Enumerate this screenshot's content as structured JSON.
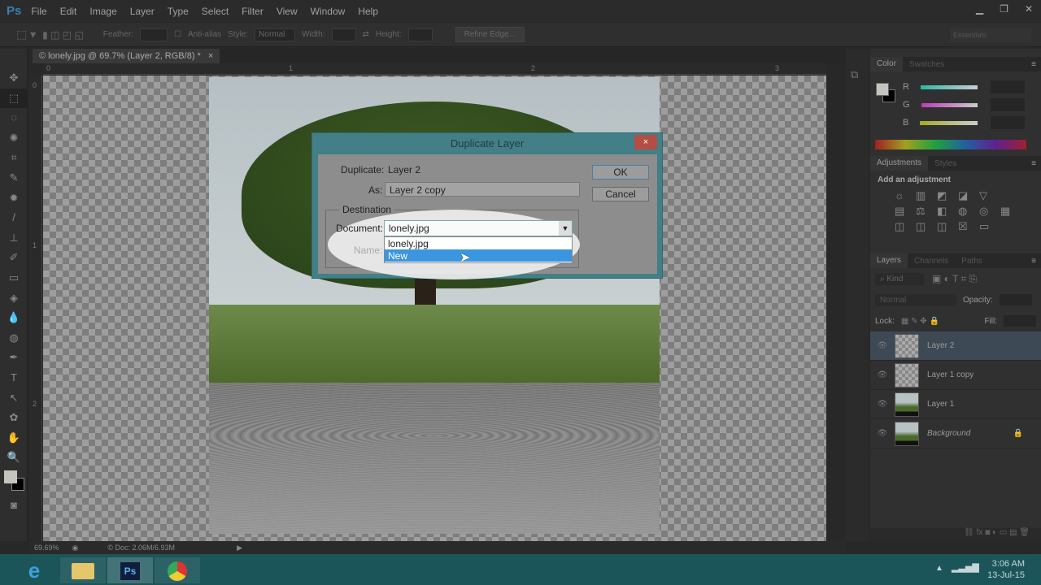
{
  "app": {
    "logo": "Ps"
  },
  "menu": [
    "File",
    "Edit",
    "Image",
    "Layer",
    "Type",
    "Select",
    "Filter",
    "View",
    "Window",
    "Help"
  ],
  "window_controls": [
    "minimize-icon",
    "restore-icon",
    "close-icon"
  ],
  "options": {
    "feather_label": "Feather:",
    "antialias_label": "Anti-alias",
    "style_label": "Style:",
    "style_value": "Normal",
    "width_label": "Width:",
    "height_label": "Height:",
    "refine_edge": "Refine Edge...",
    "workspace": "Essentials"
  },
  "document_tab": {
    "title": "© lonely.jpg @ 69.7% (Layer 2, RGB/8) *",
    "close": "×"
  },
  "rulers": {
    "top": [
      "0",
      "1",
      "2",
      "3"
    ],
    "left": [
      "0",
      "1",
      "2"
    ]
  },
  "tools": [
    "✥",
    "⬚",
    "◌",
    "✺",
    "⌗",
    "✎",
    "✹",
    "/",
    "⊥",
    "✐",
    "▭",
    "◈",
    "💧",
    "◍",
    "✒",
    "T",
    "↖",
    "✿",
    "✋",
    "🔍"
  ],
  "color_panel": {
    "tabs": [
      "Color",
      "Swatches"
    ],
    "channels": [
      "R",
      "G",
      "B"
    ],
    "foreground": "#c4c6bd",
    "background": "#000000"
  },
  "adjustments_panel": {
    "tabs": [
      "Adjustments",
      "Styles"
    ],
    "heading": "Add an adjustment",
    "icons": [
      "☼",
      "▥",
      "◩",
      "◪",
      "▽",
      "▤",
      "⚖",
      "◧",
      "◍",
      "◎",
      "▦",
      "◫",
      "◫",
      "◫",
      "☒",
      "▭"
    ]
  },
  "layers_panel": {
    "tabs": [
      "Layers",
      "Channels",
      "Paths"
    ],
    "kind": "Kind",
    "blend_mode": "Normal",
    "opacity_label": "Opacity:",
    "lock_label": "Lock:",
    "fill_label": "Fill:",
    "layers": [
      {
        "name": "Layer 2",
        "selected": true
      },
      {
        "name": "Layer 1 copy",
        "selected": false
      },
      {
        "name": "Layer 1",
        "selected": false
      },
      {
        "name": "Background",
        "selected": false,
        "locked": true
      }
    ]
  },
  "status": {
    "zoom": "69.69%",
    "doc": "© Doc: 2.06M/6.93M"
  },
  "dialog": {
    "title": "Duplicate Layer",
    "close": "×",
    "duplicate_label": "Duplicate:",
    "duplicate_value": "Layer 2",
    "as_label": "As:",
    "as_value": "Layer 2 copy",
    "destination_label": "Destination",
    "document_label": "Document:",
    "document_value": "lonely.jpg",
    "name_label": "Name:",
    "options": [
      "lonely.jpg",
      "New"
    ],
    "highlighted": "New",
    "ok": "OK",
    "cancel": "Cancel"
  },
  "taskbar": {
    "apps": [
      "internet-explorer",
      "file-explorer",
      "photoshop",
      "chrome"
    ],
    "ps_label": "Ps",
    "time": "3:06 AM",
    "date": "13-Jul-15"
  }
}
